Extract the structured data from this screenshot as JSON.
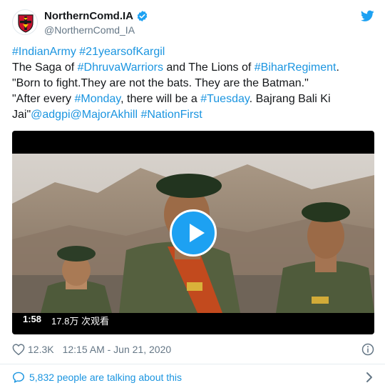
{
  "tweet": {
    "display_name": "NorthernComd.IA",
    "handle": "@NorthernComd_IA",
    "verified": true,
    "lines": [
      [
        {
          "t": "#IndianArmy",
          "h": true
        },
        {
          "t": " ",
          "h": false
        },
        {
          "t": "#21yearsofKargil",
          "h": true
        }
      ],
      [
        {
          "t": "The Saga of ",
          "h": false
        },
        {
          "t": "#DhruvaWarriors",
          "h": true
        },
        {
          "t": " and The Lions of ",
          "h": false
        },
        {
          "t": "#BiharRegiment",
          "h": true
        },
        {
          "t": ".",
          "h": false
        }
      ],
      [
        {
          "t": "\"Born to fight.They are not the bats. They are the Batman.\"",
          "h": false
        }
      ],
      [
        {
          "t": "\"After every ",
          "h": false
        },
        {
          "t": "#Monday",
          "h": true
        },
        {
          "t": ", there will be a ",
          "h": false
        },
        {
          "t": "#Tuesday",
          "h": true
        },
        {
          "t": ". Bajrang Bali Ki",
          "h": false
        }
      ],
      [
        {
          "t": "Jai\"",
          "h": false
        },
        {
          "t": "@adgpi",
          "h": true
        },
        {
          "t": "@MajorAkhill",
          "h": true
        },
        {
          "t": " ",
          "h": false
        },
        {
          "t": "#NationFirst",
          "h": true
        }
      ]
    ],
    "video": {
      "duration": "1:58",
      "views": "17.8万 次观看"
    },
    "likes": "12.3K",
    "timestamp": "12:15 AM - Jun 21, 2020",
    "talking": "5,832 people are talking about this"
  },
  "colors": {
    "link": "#1b95e0",
    "brand": "#1da1f2",
    "muted": "#657786",
    "text": "#14171a"
  },
  "icons": [
    "verified-badge-icon",
    "twitter-bird-icon",
    "play-icon",
    "heart-icon",
    "info-icon",
    "comment-icon",
    "chevron-right-icon"
  ]
}
